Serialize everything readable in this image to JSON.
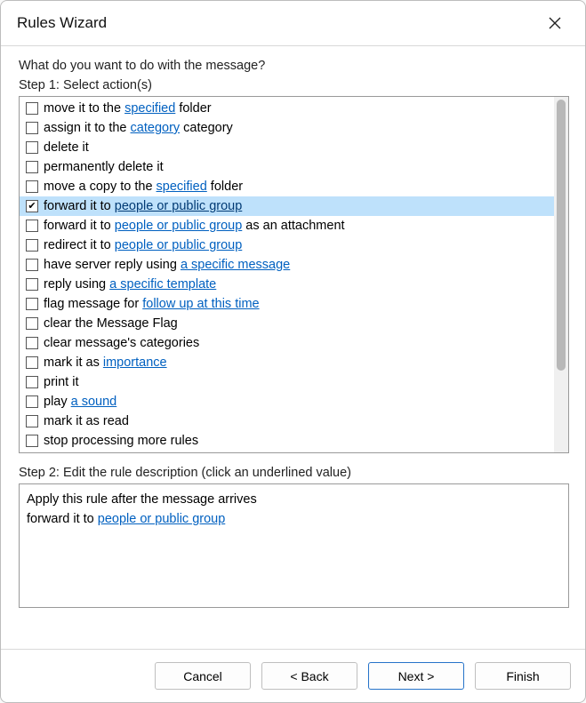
{
  "window": {
    "title": "Rules Wizard"
  },
  "prompt": "What do you want to do with the message?",
  "step1_label": "Step 1: Select action(s)",
  "step2_label": "Step 2: Edit the rule description (click an underlined value)",
  "actions": [
    {
      "checked": false,
      "selected": false,
      "parts": [
        {
          "t": "move it to the "
        },
        {
          "t": "specified",
          "u": true
        },
        {
          "t": " folder"
        }
      ]
    },
    {
      "checked": false,
      "selected": false,
      "parts": [
        {
          "t": "assign it to the "
        },
        {
          "t": "category",
          "u": true
        },
        {
          "t": " category"
        }
      ]
    },
    {
      "checked": false,
      "selected": false,
      "parts": [
        {
          "t": "delete it"
        }
      ]
    },
    {
      "checked": false,
      "selected": false,
      "parts": [
        {
          "t": "permanently delete it"
        }
      ]
    },
    {
      "checked": false,
      "selected": false,
      "parts": [
        {
          "t": "move a copy to the "
        },
        {
          "t": "specified",
          "u": true
        },
        {
          "t": " folder"
        }
      ]
    },
    {
      "checked": true,
      "selected": true,
      "parts": [
        {
          "t": "forward it to "
        },
        {
          "t": "people or public group",
          "u": true
        }
      ]
    },
    {
      "checked": false,
      "selected": false,
      "parts": [
        {
          "t": "forward it to "
        },
        {
          "t": "people or public group",
          "u": true
        },
        {
          "t": " as an attachment"
        }
      ]
    },
    {
      "checked": false,
      "selected": false,
      "parts": [
        {
          "t": "redirect it to "
        },
        {
          "t": "people or public group",
          "u": true
        }
      ]
    },
    {
      "checked": false,
      "selected": false,
      "parts": [
        {
          "t": "have server reply using "
        },
        {
          "t": "a specific message",
          "u": true
        }
      ]
    },
    {
      "checked": false,
      "selected": false,
      "parts": [
        {
          "t": "reply using "
        },
        {
          "t": "a specific template",
          "u": true
        }
      ]
    },
    {
      "checked": false,
      "selected": false,
      "parts": [
        {
          "t": "flag message for "
        },
        {
          "t": "follow up at this time",
          "u": true
        }
      ]
    },
    {
      "checked": false,
      "selected": false,
      "parts": [
        {
          "t": "clear the Message Flag"
        }
      ]
    },
    {
      "checked": false,
      "selected": false,
      "parts": [
        {
          "t": "clear message's categories"
        }
      ]
    },
    {
      "checked": false,
      "selected": false,
      "parts": [
        {
          "t": "mark it as "
        },
        {
          "t": "importance",
          "u": true
        }
      ]
    },
    {
      "checked": false,
      "selected": false,
      "parts": [
        {
          "t": "print it"
        }
      ]
    },
    {
      "checked": false,
      "selected": false,
      "parts": [
        {
          "t": "play "
        },
        {
          "t": "a sound",
          "u": true
        }
      ]
    },
    {
      "checked": false,
      "selected": false,
      "parts": [
        {
          "t": "mark it as read"
        }
      ]
    },
    {
      "checked": false,
      "selected": false,
      "parts": [
        {
          "t": "stop processing more rules"
        }
      ]
    }
  ],
  "description": {
    "line1": "Apply this rule after the message arrives",
    "line2_prefix": "forward it to ",
    "line2_link": "people or public group"
  },
  "buttons": {
    "cancel": "Cancel",
    "back": "< Back",
    "next": "Next >",
    "finish": "Finish"
  }
}
